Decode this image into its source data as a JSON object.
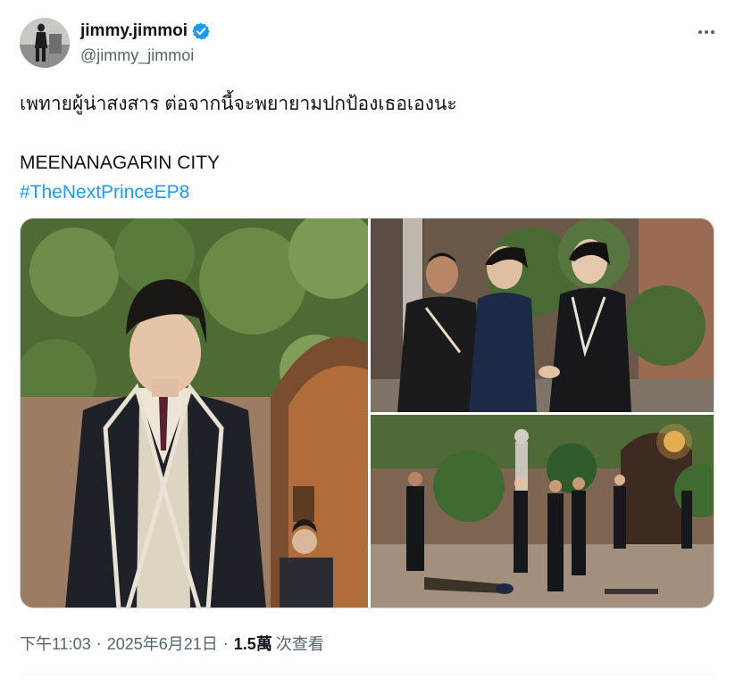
{
  "tweet": {
    "display_name": "jimmy.jimmoi",
    "handle": "@jimmy_jimmoi",
    "text_lines": [
      "เพทายผู้น่าสงสาร ต่อจากนี้จะพยายามปกป้องเธอเองนะ",
      "",
      "MEENANAGARIN CITY"
    ],
    "hashtag": "#TheNextPrinceEP8",
    "time": "下午11:03",
    "date": "2025年6月21日",
    "views_count": "1.5萬",
    "views_label": "次查看",
    "separator": "·"
  },
  "colors": {
    "accent": "#1d9bf0",
    "secondary_text": "#536471",
    "primary_text": "#0f1419"
  },
  "icons": {
    "verified": "verified-badge-icon",
    "more": "more-options-icon"
  },
  "media": {
    "photos": [
      "photo-student-portrait",
      "photo-three-men-handshake",
      "photo-courtyard-scene"
    ]
  }
}
